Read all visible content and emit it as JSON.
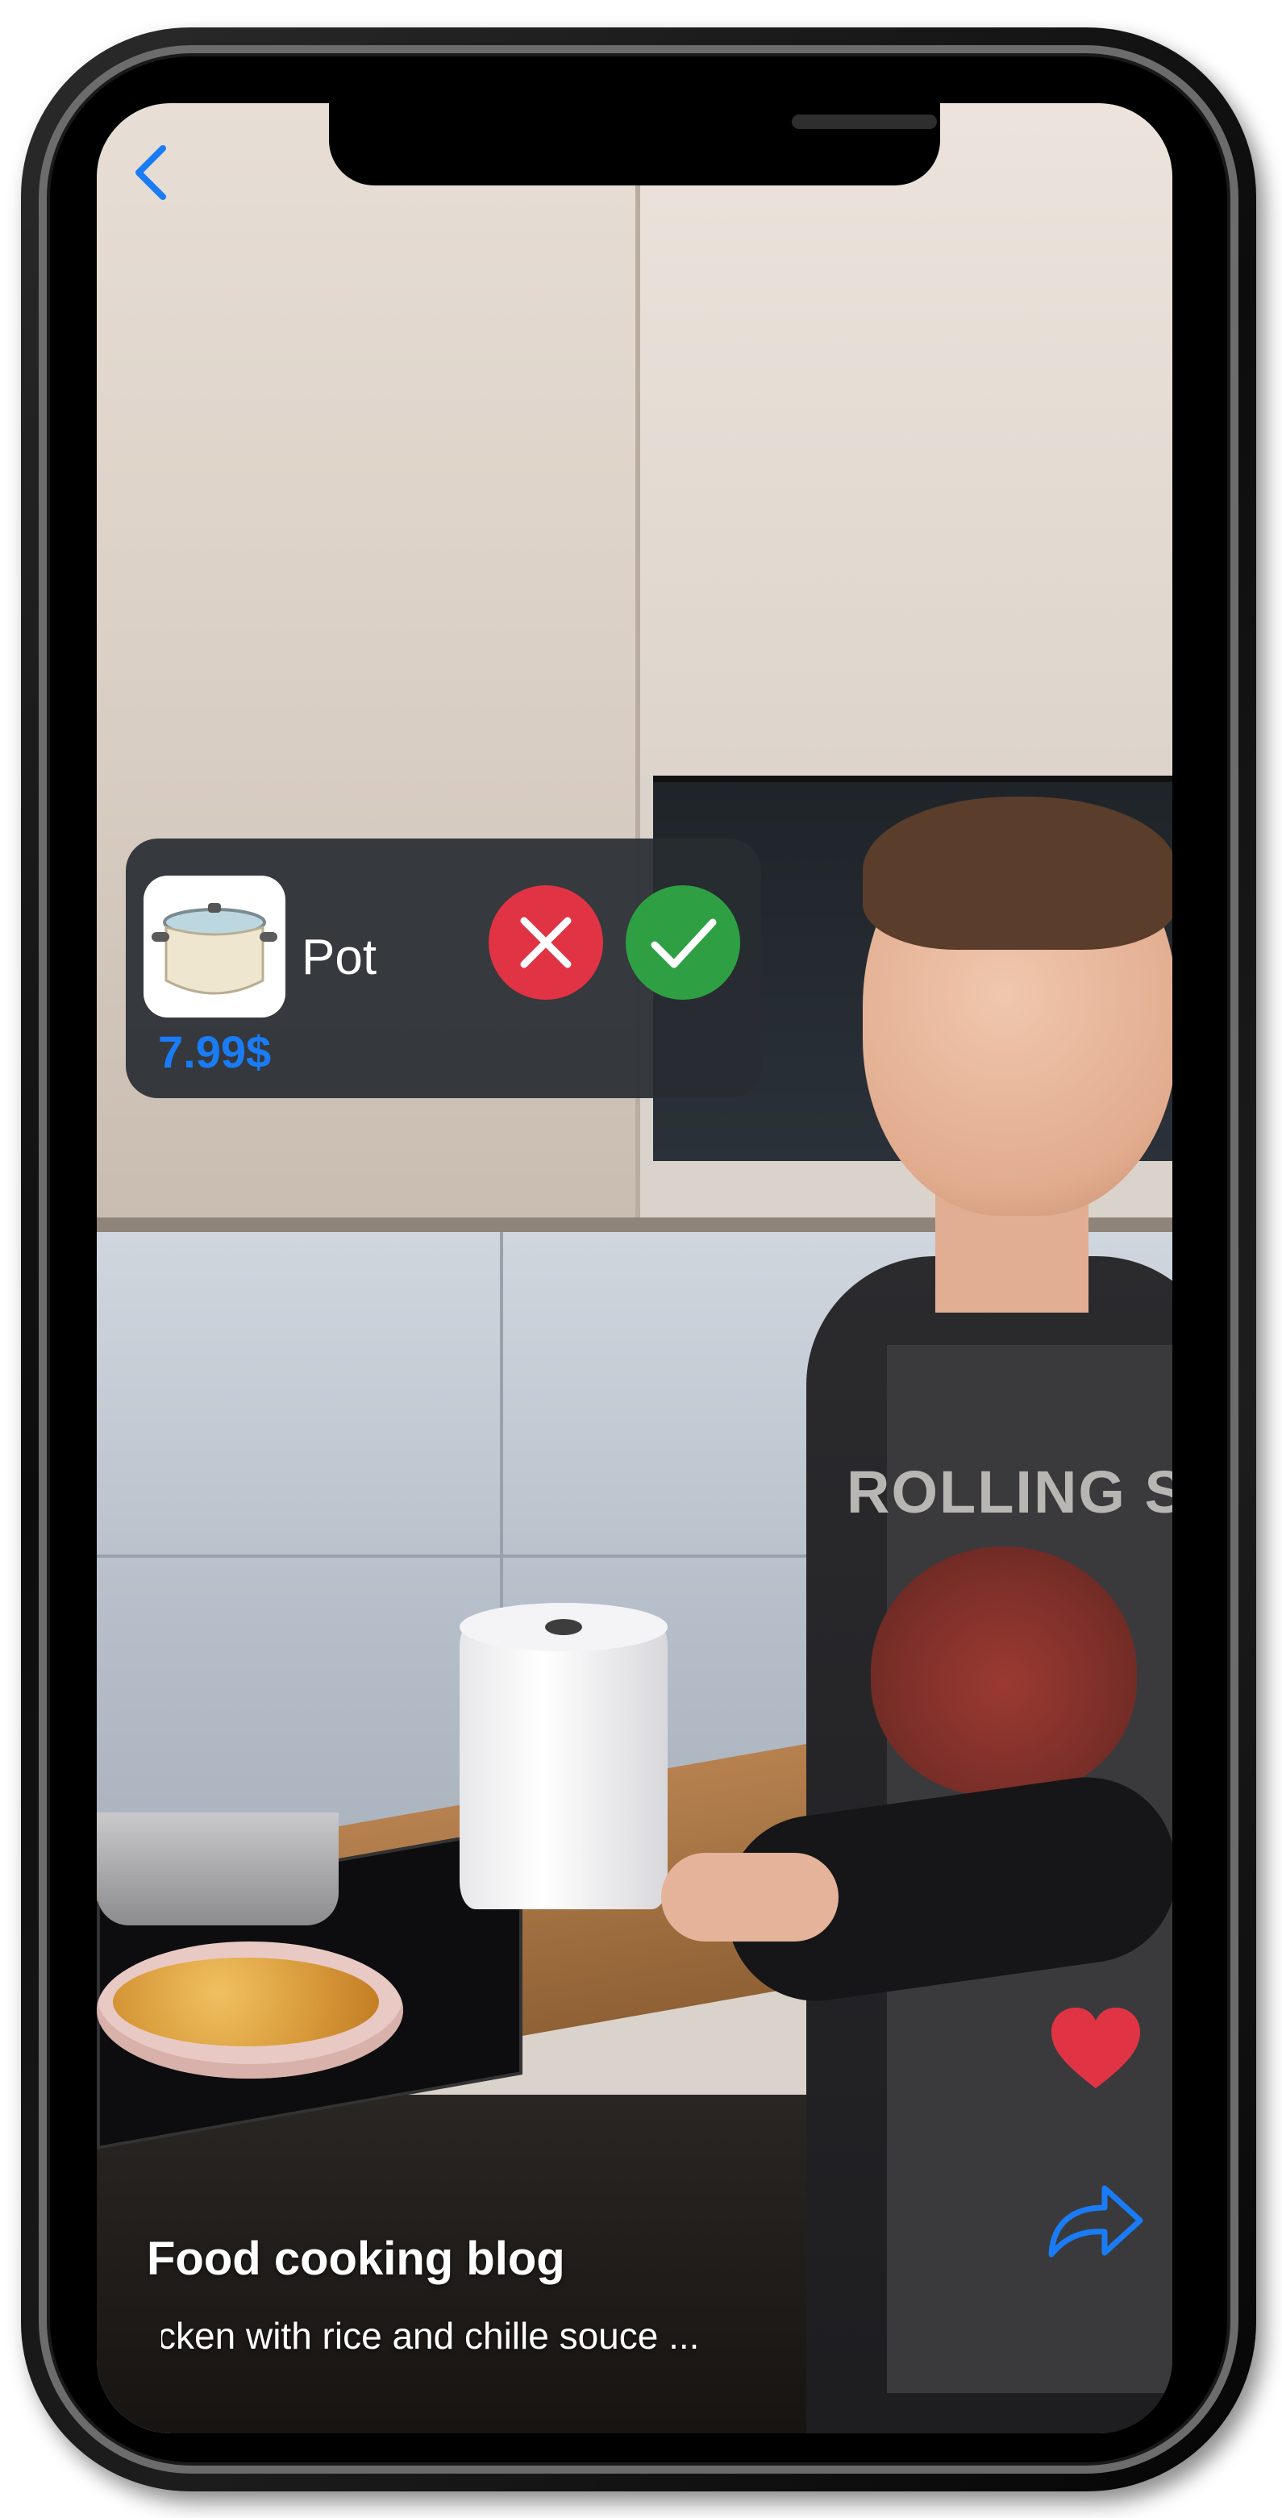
{
  "product_card": {
    "name": "Pot",
    "price": "7.99$",
    "thumbnail_icon": "cooking-pot-icon"
  },
  "actions": {
    "back_icon": "chevron-left-icon",
    "reject_icon": "close-icon",
    "accept_icon": "check-icon",
    "like_icon": "heart-icon",
    "share_icon": "share-arrow-icon"
  },
  "background_text": {
    "shirt_print": "ROLLING STON"
  },
  "feed": {
    "title": "Food cooking blog",
    "caption": "Chicken with rice and chille souce ..."
  },
  "colors": {
    "accent_blue": "#1a7cf5",
    "reject_red": "#e03445",
    "accept_green": "#2ea043",
    "like_red": "#e03445",
    "popup_bg": "#282c32"
  }
}
